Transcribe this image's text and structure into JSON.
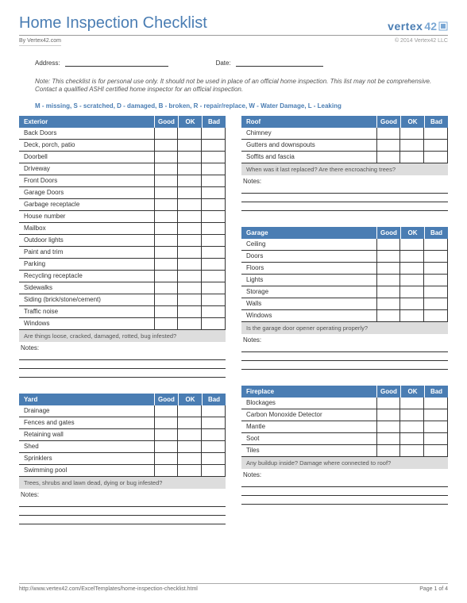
{
  "header": {
    "title": "Home Inspection Checklist",
    "byline": "By Vertex42.com",
    "logo_text": "vertex",
    "logo_num": "42",
    "copyright": "© 2014 Vertex42 LLC"
  },
  "fields": {
    "address_label": "Address:",
    "date_label": "Date:"
  },
  "note": "Note: This checklist is for personal use only. It should not be used in place of an official home inspection. This list may not be comprehensive. Contact a qualified ASHI certified home inspector for an official inspection.",
  "legend": "M - missing,  S - scratched, D - damaged,  B - broken,  R - repair/replace, W - Water Damage,  L - Leaking",
  "col_headers": {
    "good": "Good",
    "ok": "OK",
    "bad": "Bad"
  },
  "notes_label": "Notes:",
  "sections": {
    "exterior": {
      "title": "Exterior",
      "items": [
        "Back Doors",
        "Deck, porch, patio",
        "Doorbell",
        "Driveway",
        "Front Doors",
        "Garage Doors",
        "Garbage receptacle",
        "House number",
        "Mailbox",
        "Outdoor lights",
        "Paint and trim",
        "Parking",
        "Recycling receptacle",
        "Sidewalks",
        "Siding (brick/stone/cement)",
        "Traffic noise",
        "Windows"
      ],
      "prompt": "Are things loose, cracked, damaged, rotted, bug infested?"
    },
    "roof": {
      "title": "Roof",
      "items": [
        "Chimney",
        "Gutters and downspouts",
        "Soffits and fascia"
      ],
      "prompt": "When was it last replaced? Are there encroaching trees?"
    },
    "garage": {
      "title": "Garage",
      "items": [
        "Ceiling",
        "Doors",
        "Floors",
        "Lights",
        "Storage",
        "Walls",
        "Windows"
      ],
      "prompt": "Is the garage door opener operating properly?"
    },
    "yard": {
      "title": "Yard",
      "items": [
        "Drainage",
        "Fences and gates",
        "Retaining wall",
        "Shed",
        "Sprinklers",
        "Swimming pool"
      ],
      "prompt": "Trees, shrubs and lawn dead, dying or bug infested?"
    },
    "fireplace": {
      "title": "Fireplace",
      "items": [
        "Blockages",
        "Carbon Monoxide Detector",
        "Mantle",
        "Soot",
        "Tiles"
      ],
      "prompt": "Any buildup inside? Damage where connected to roof?"
    }
  },
  "footer": {
    "url": "http://www.vertex42.com/ExcelTemplates/home-inspection-checklist.html",
    "page": "Page 1 of 4"
  }
}
